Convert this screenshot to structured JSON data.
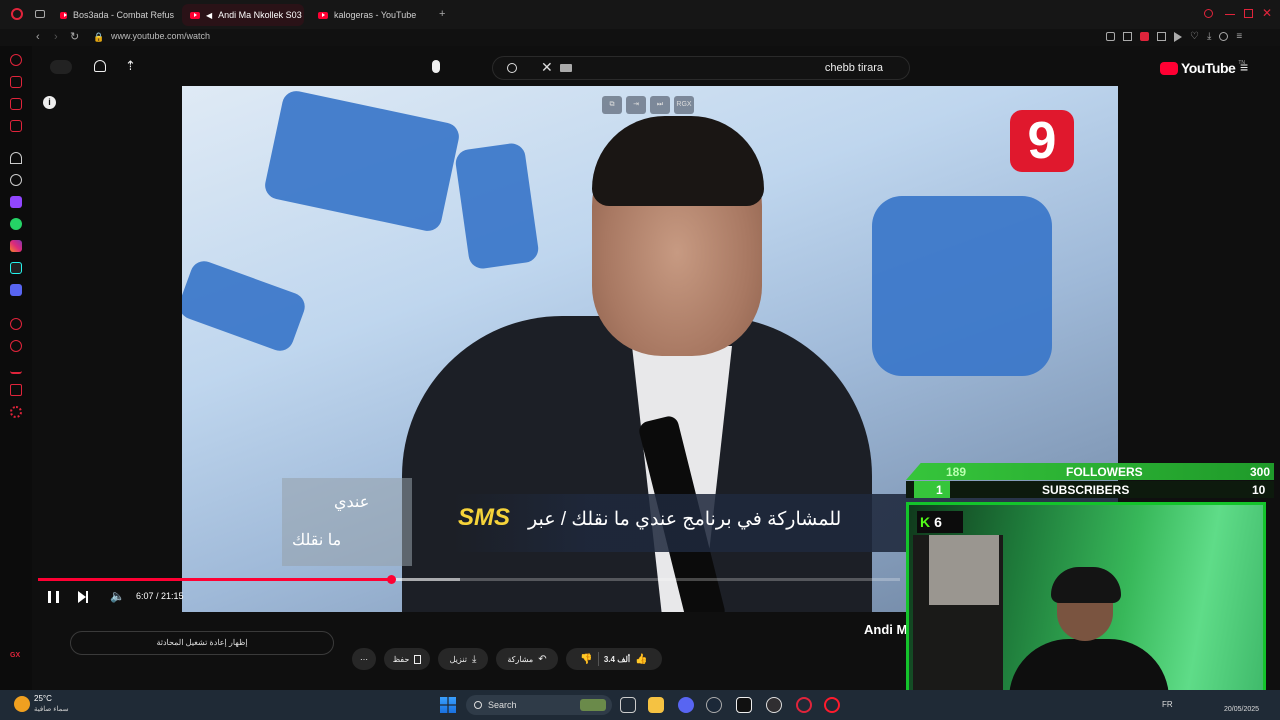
{
  "browser": {
    "tabs": [
      {
        "label": "Bos3ada - Combat Refus",
        "active": false
      },
      {
        "label": "Andi Ma Nkollek S03",
        "active": true
      },
      {
        "label": "kalogeras - YouTube",
        "active": false
      }
    ],
    "new_tab": "+",
    "url": "www.youtube.com/watch"
  },
  "youtube": {
    "brand": "YouTube",
    "brand_sup": "TN",
    "search_value": "chebb tirara"
  },
  "video": {
    "channel_logo": "9",
    "overlay_buttons": [
      "",
      "",
      "",
      "RGX"
    ],
    "ticker_sms": "SMS",
    "ticker_text": "للمشاركة في برنامج عندي ما نقلك / عبر",
    "left_line1": "عندي",
    "left_line2": "ما نقلك",
    "time": "6:07 / 21:15",
    "progress": 0.41,
    "buffered": 0.49
  },
  "below": {
    "title_partial": "Andi M",
    "autoplay_label": "إظهار إعادة تشغيل المحادثة",
    "actions": {
      "more": "⋯",
      "save": "حفظ",
      "download": "تنزيل",
      "share": "مشاركة",
      "likes": "3.4 ألف"
    }
  },
  "stream_overlay": {
    "followers_current": "189",
    "followers_label": "FOLLOWERS",
    "followers_goal": "300",
    "subs_current": "1",
    "subs_label": "SUBSCRIBERS",
    "subs_goal": "10",
    "kick_count": "6",
    "kick_logo": "K"
  },
  "taskbar": {
    "temp": "25°C",
    "weather_desc": "سماء صافية",
    "search": "Search",
    "lang": "FR",
    "date_partial": "20/05/2025"
  },
  "colors": {
    "yt_red": "#ff0033",
    "kick_green": "#53fc18",
    "overlay_green": "#36c53b"
  }
}
